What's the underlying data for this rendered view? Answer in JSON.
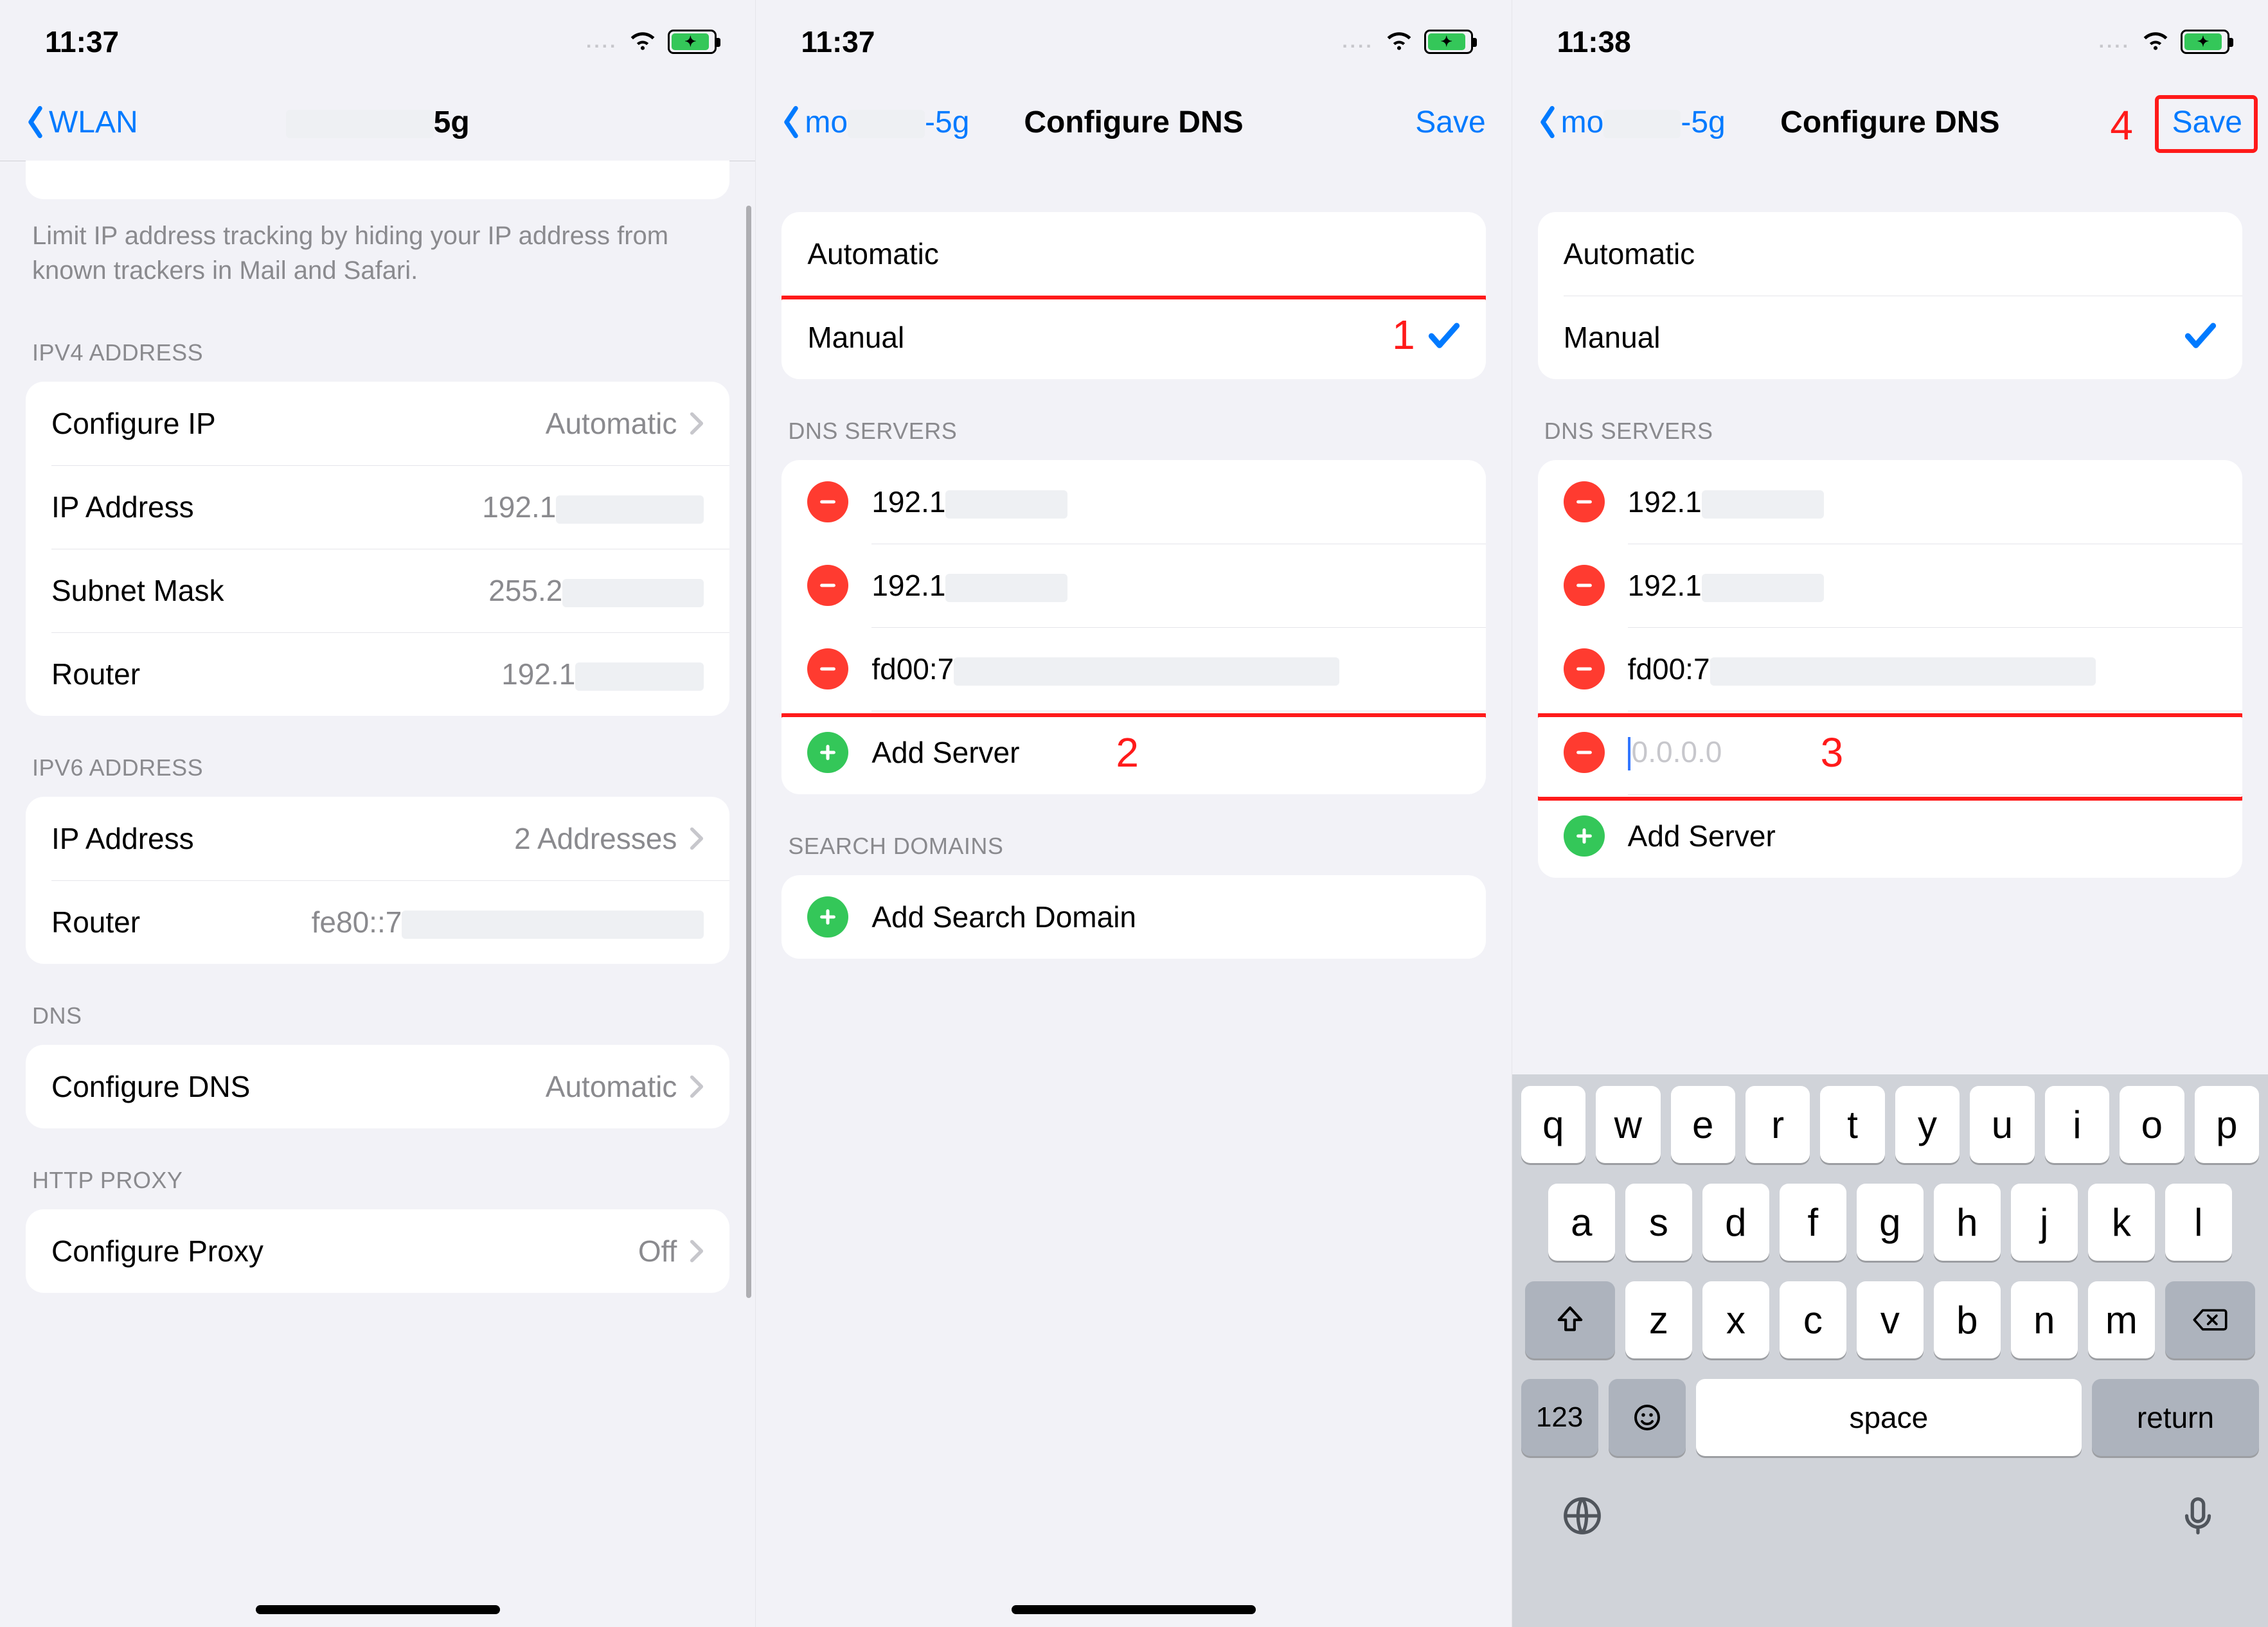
{
  "status": {
    "time1": "11:37",
    "time2": "11:37",
    "time3": "11:38"
  },
  "annotations": {
    "n1": "1",
    "n2": "2",
    "n3": "3",
    "n4": "4"
  },
  "s1": {
    "back": "WLAN",
    "title_suffix": "5g",
    "note": "Limit IP address tracking by hiding your IP address from known trackers in Mail and Safari.",
    "sec_ipv4": "IPV4 ADDRESS",
    "configure_ip": "Configure IP",
    "configure_ip_val": "Automatic",
    "ip_addr": "IP Address",
    "ip_addr_val": "192.1",
    "subnet": "Subnet Mask",
    "subnet_val": "255.2",
    "router4": "Router",
    "router4_val": "192.1",
    "sec_ipv6": "IPV6 ADDRESS",
    "ip6_addr": "IP Address",
    "ip6_addr_val": "2 Addresses",
    "router6": "Router",
    "router6_val": "fe80::7",
    "sec_dns": "DNS",
    "cfg_dns": "Configure DNS",
    "cfg_dns_val": "Automatic",
    "sec_proxy": "HTTP PROXY",
    "cfg_proxy": "Configure Proxy",
    "cfg_proxy_val": "Off"
  },
  "s2": {
    "back_a": "mo",
    "back_b": "-5g",
    "title": "Configure DNS",
    "save": "Save",
    "auto": "Automatic",
    "manual": "Manual",
    "sec_servers": "DNS SERVERS",
    "srv1": "192.1",
    "srv2": "192.1",
    "srv3": "fd00:7",
    "add_server": "Add Server",
    "sec_domains": "SEARCH DOMAINS",
    "add_domain": "Add Search Domain"
  },
  "s3": {
    "back_a": "mo",
    "back_b": "-5g",
    "title": "Configure DNS",
    "save": "Save",
    "auto": "Automatic",
    "manual": "Manual",
    "sec_servers": "DNS SERVERS",
    "srv1": "192.1",
    "srv2": "192.1",
    "srv3": "fd00:7",
    "new_placeholder": "0.0.0.0",
    "add_server": "Add Server",
    "kbd": {
      "r1": [
        "q",
        "w",
        "e",
        "r",
        "t",
        "y",
        "u",
        "i",
        "o",
        "p"
      ],
      "r2": [
        "a",
        "s",
        "d",
        "f",
        "g",
        "h",
        "j",
        "k",
        "l"
      ],
      "r3": [
        "z",
        "x",
        "c",
        "v",
        "b",
        "n",
        "m"
      ],
      "num": "123",
      "space": "space",
      "return": "return"
    }
  }
}
